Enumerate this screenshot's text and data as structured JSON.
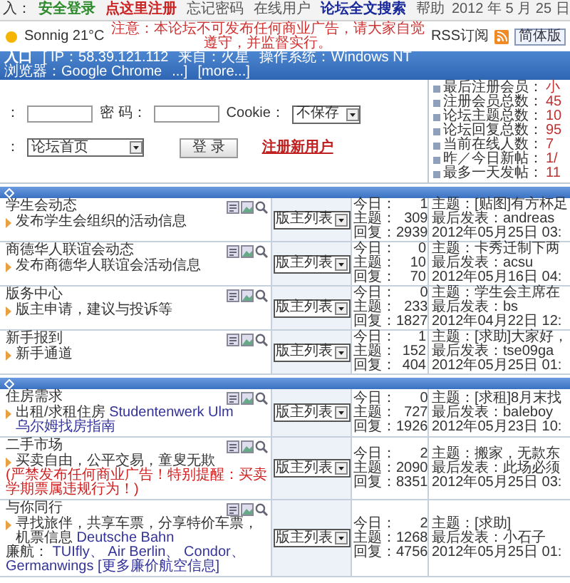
{
  "top_nav": {
    "prefix": "入：",
    "links": [
      {
        "label": "安全登录",
        "color": "#2e8b2e"
      },
      {
        "label": "点这里注册",
        "color": "#cc2222"
      },
      {
        "label": "忘记密码"
      },
      {
        "label": "在线用户"
      },
      {
        "label": "论坛全文搜索",
        "color": "#1a2a9a"
      },
      {
        "label": "帮助"
      }
    ],
    "date": "2012 年 5 月 25 日"
  },
  "info_bar": {
    "weather": "Sonnig 21°C",
    "notice": "注意：本论坛不可发布任何商业广告，请大家自觉遵守，并监督实行。",
    "rss": "RSS订阅",
    "buttons": [
      "简体版"
    ]
  },
  "visitor_bar": {
    "title": "入口",
    "items": [
      "[ IP：58.39.121.112",
      "来自：火星",
      "操作系统：Windows NT",
      "浏览器：Google Chrome",
      "...]"
    ],
    "more": "[more...]"
  },
  "login": {
    "username_label": "：",
    "password_label": "密 码：",
    "cookie_label": "Cookie：",
    "cookie_value": "不保存",
    "jump_label": "：",
    "jump_value": "论坛首页",
    "submit": "登 录",
    "register": "注册新用户"
  },
  "stats": [
    {
      "label": "最后注册会员：",
      "value": "小"
    },
    {
      "label": "注册会员总数：",
      "value": "45"
    },
    {
      "label": "论坛主题总数：",
      "value": "10"
    },
    {
      "label": "论坛回复总数：",
      "value": "95"
    },
    {
      "label": "当前在线人数：",
      "value": "7"
    },
    {
      "label": "昨／今日新帖：",
      "value": "1/"
    },
    {
      "label": "最多一天发帖：",
      "value": "11"
    }
  ],
  "sections": [
    {
      "forums": [
        {
          "name": "学生会动态",
          "description": [
            [
              {
                "kind": "text",
                "text": "发布学生会组织的活动信息"
              }
            ]
          ],
          "moderators": "版主列表",
          "counts": [
            {
              "label": "今日：",
              "value": "1"
            },
            {
              "label": "主题：",
              "value": "309"
            },
            {
              "label": "回复：",
              "value": "2939"
            }
          ],
          "last_post": {
            "topic": "主题：[贴图]有方杯足",
            "author": "最后发表：andreas",
            "time": "2012年05月25日 03:"
          }
        },
        {
          "name": "商德华人联谊会动态",
          "description": [
            [
              {
                "kind": "text",
                "text": "发布商德华人联谊会活动信息"
              }
            ]
          ],
          "moderators": "版主列表",
          "counts": [
            {
              "label": "今日：",
              "value": "0"
            },
            {
              "label": "主题：",
              "value": "10"
            },
            {
              "label": "回复：",
              "value": "70"
            }
          ],
          "last_post": {
            "topic": "主题：卡秀迁制下两",
            "author": "最后发表：acsu",
            "time": "2012年05月16日 04:"
          }
        },
        {
          "name": "版务中心",
          "description": [
            [
              {
                "kind": "text",
                "text": "版主申请，建议与投诉等"
              }
            ]
          ],
          "moderators": "版主列表",
          "counts": [
            {
              "label": "今日：",
              "value": "0"
            },
            {
              "label": "主题：",
              "value": "233"
            },
            {
              "label": "回复：",
              "value": "1827"
            }
          ],
          "last_post": {
            "topic": "主题：学生会主席在",
            "author": "最后发表：bs",
            "time": "2012年04月22日 12:"
          }
        },
        {
          "name": "新手报到",
          "description": [
            [
              {
                "kind": "text",
                "text": "新手通道"
              }
            ]
          ],
          "moderators": "版主列表",
          "counts": [
            {
              "label": "今日：",
              "value": "1"
            },
            {
              "label": "主题：",
              "value": "152"
            },
            {
              "label": "回复：",
              "value": "404"
            }
          ],
          "last_post": {
            "topic": "主题：[求助]大家好，",
            "author": "最后发表：tse09ga",
            "time": "2012年05月25日 01:"
          }
        }
      ]
    },
    {
      "forums": [
        {
          "name": "住房需求",
          "description": [
            [
              {
                "kind": "text",
                "text": "出租/求租住房"
              },
              {
                "kind": "link",
                "text": "Studentenwerk Ulm"
              },
              {
                "kind": "link",
                "text": "乌尔姆找房指南"
              }
            ]
          ],
          "moderators": "版主列表",
          "counts": [
            {
              "label": "今日：",
              "value": "0"
            },
            {
              "label": "主题：",
              "value": "727"
            },
            {
              "label": "回复：",
              "value": "1926"
            }
          ],
          "last_post": {
            "topic": "主题：[求租]8月末找",
            "author": "最后发表：baleboy",
            "time": "2012年05月23日 10:"
          }
        },
        {
          "name": "二手市场",
          "description": [
            [
              {
                "kind": "text",
                "text": "买卖自由，公平交易，童叟无欺"
              }
            ],
            [
              {
                "kind": "warning",
                "text": "(严禁发布任何商业广告！特别提醒：买卖学期票属违规行为！)"
              }
            ]
          ],
          "moderators": "版主列表",
          "counts": [
            {
              "label": "今日：",
              "value": "2"
            },
            {
              "label": "主题：",
              "value": "2090"
            },
            {
              "label": "回复：",
              "value": "8351"
            }
          ],
          "last_post": {
            "topic": "主题：搬家，无款东",
            "author": "最后发表：此场必须",
            "time": "2012年05月25日 03:"
          }
        },
        {
          "name": "与你同行",
          "description": [
            [
              {
                "kind": "text",
                "text": "寻找旅伴，共享车票，分享特价车票，机票信息"
              },
              {
                "kind": "link",
                "text": "Deutsche Bahn"
              }
            ],
            [
              {
                "kind": "text",
                "text": "廉航："
              },
              {
                "kind": "link",
                "text": "TUIfly、"
              },
              {
                "kind": "link",
                "text": "Air Berlin、"
              },
              {
                "kind": "link",
                "text": "Condor、"
              },
              {
                "kind": "link",
                "text": "Germanwings"
              },
              {
                "kind": "link",
                "text": "[更多廉价航空信息]"
              }
            ]
          ],
          "moderators": "版主列表",
          "counts": [
            {
              "label": "今日：",
              "value": "2"
            },
            {
              "label": "主题：",
              "value": "1268"
            },
            {
              "label": "回复：",
              "value": "4756"
            }
          ],
          "last_post": {
            "topic": "主题：[求助]",
            "author": "最后发表：小石子",
            "time": "2012年05月25日 01:"
          }
        }
      ]
    }
  ]
}
